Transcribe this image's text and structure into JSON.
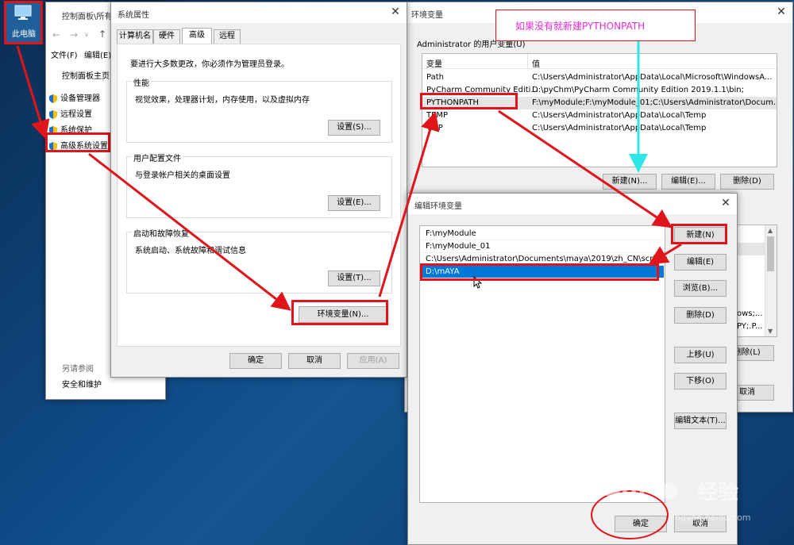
{
  "desktop": {
    "this_pc_label": "此电脑"
  },
  "control_panel": {
    "title": "控制面板\\所有",
    "menu": [
      "文件(F)",
      "编辑(E)"
    ],
    "home": "控制面板主页",
    "links": [
      "设备管理器",
      "远程设置",
      "系统保护",
      "高级系统设置"
    ],
    "see_also": "另请参阅",
    "security": "安全和维护"
  },
  "sys_props": {
    "title": "系统属性",
    "tabs": [
      "计算机名",
      "硬件",
      "高级",
      "远程"
    ],
    "admin_note": "要进行大多数更改，你必须作为管理员登录。",
    "performance": {
      "title": "性能",
      "desc": "视觉效果，处理器计划，内存使用，以及虚拟内存",
      "button": "设置(S)..."
    },
    "profile": {
      "title": "用户配置文件",
      "desc": "与登录帐户相关的桌面设置",
      "button": "设置(E)..."
    },
    "startup": {
      "title": "启动和故障恢复",
      "desc": "系统启动、系统故障和调试信息",
      "button": "设置(T)..."
    },
    "env_button": "环境变量(N)...",
    "ok": "确定",
    "cancel": "取消",
    "apply": "应用(A)"
  },
  "env_vars": {
    "title": "环境变量",
    "user_group": "Administrator 的用户变量(U)",
    "col_var": "变量",
    "col_val": "值",
    "rows": [
      {
        "name": "Path",
        "value": "C:\\Users\\Administrator\\AppData\\Local\\Microsoft\\WindowsA..."
      },
      {
        "name": "PyCharm Community Editi...",
        "value": "D:\\pyChm\\PyCharm Community Edition 2019.1.1\\bin;"
      },
      {
        "name": "PYTHONPATH",
        "value": "F:\\myModule;F:\\myModule_01;C:\\Users\\Administrator\\Docum..."
      },
      {
        "name": "TEMP",
        "value": "C:\\Users\\Administrator\\AppData\\Local\\Temp"
      },
      {
        "name": "TMP",
        "value": "C:\\Users\\Administrator\\AppData\\Local\\Temp"
      }
    ],
    "new": "新建(N)...",
    "edit": "编辑(E)...",
    "delete": "删除(D)",
    "sys_frag1": "ows;...",
    "sys_frag2": "PY;.P...",
    "sys_delete": "删除(L)",
    "sys_cancel": "取消"
  },
  "edit_env": {
    "title": "编辑环境变量",
    "entries": [
      "F:\\myModule",
      "F:\\myModule_01",
      "C:\\Users\\Administrator\\Documents\\maya\\2019\\zh_CN\\scripts",
      "D:\\mAYA"
    ],
    "buttons": [
      "新建(N)",
      "编辑(E)",
      "浏览(B)...",
      "删除(D)",
      "上移(U)",
      "下移(O)",
      "编辑文本(T)..."
    ],
    "ok": "确定",
    "cancel": "取消"
  },
  "annotation": "如果没有就新建PYTHONPATH",
  "watermark": {
    "brand": "Bai",
    "brand2": "经验",
    "url": "jingyan.baidu.com"
  },
  "colors": {
    "red": "#e0151b",
    "selection": "#0078d7",
    "annotation": "#e92bd6",
    "cyan": "#2ee6e6"
  }
}
